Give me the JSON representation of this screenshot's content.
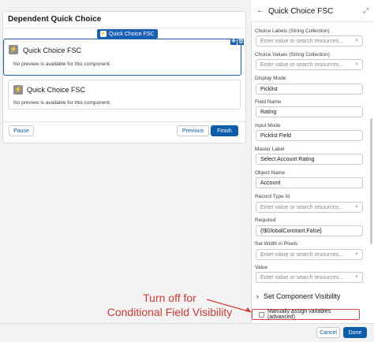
{
  "screen": {
    "title": "Dependent Quick Choice",
    "component_tag": "Quick Choice FSC",
    "components": [
      {
        "title": "Quick Choice FSC",
        "note": "No preview is available for this component."
      },
      {
        "title": "Quick Choice FSC",
        "note": "No preview is available for this component."
      }
    ],
    "buttons": {
      "pause": "Pause",
      "previous": "Previous",
      "finish": "Finish"
    }
  },
  "panel": {
    "title": "Quick Choice FSC",
    "fields": [
      {
        "label": "Choice Labels (String Collection)",
        "value": "",
        "placeholder": "Enter value or search resources..."
      },
      {
        "label": "Choice Values (String Collection)",
        "value": "",
        "placeholder": "Enter value or search resources..."
      },
      {
        "label": "Display Mode",
        "value": "Picklist"
      },
      {
        "label": "Field Name",
        "value": "Rating"
      },
      {
        "label": "Input Mode",
        "value": "Picklist Field"
      },
      {
        "label": "Master Label",
        "value": "Select Account Rating"
      },
      {
        "label": "Object Name",
        "value": "Account"
      },
      {
        "label": "Record Type Id",
        "value": "",
        "placeholder": "Enter value or search resources..."
      },
      {
        "label": "Required",
        "value": "{!$GlobalConstant.False}"
      },
      {
        "label": "Set Width in Pixels",
        "value": "",
        "placeholder": "Enter value or search resources..."
      },
      {
        "label": "Value",
        "value": "",
        "placeholder": "Enter value or search resources..."
      }
    ],
    "section": "Set Component Visibility",
    "manual_assign": "Manually assign variables (advanced)"
  },
  "footer": {
    "cancel": "Cancel",
    "done": "Done"
  },
  "annotation": {
    "line1": "Turn off for",
    "line2": "Conditional Field Visibility"
  },
  "colors": {
    "brand": "#0b5cab",
    "annotation": "#d13b31"
  }
}
